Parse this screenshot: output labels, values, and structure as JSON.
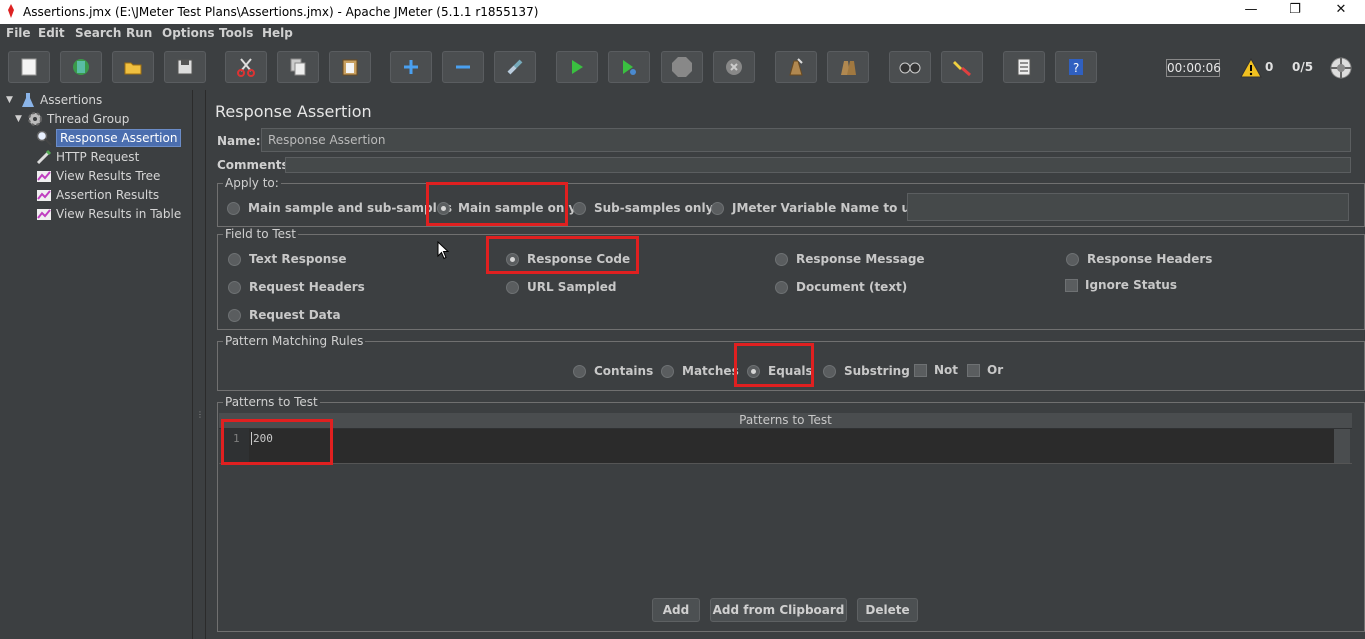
{
  "window": {
    "title": "Assertions.jmx (E:\\JMeter Test Plans\\Assertions.jmx) - Apache JMeter (5.1.1 r1855137)",
    "minimize": "—",
    "maximize": "❐",
    "close": "✕"
  },
  "menu": [
    "File",
    "Edit",
    "Search",
    "Run",
    "Options",
    "Tools",
    "Help"
  ],
  "toolbar": {
    "buttons": [
      "new-icon",
      "templates-icon",
      "open-icon",
      "save-icon",
      "cut-icon",
      "copy-icon",
      "paste-icon",
      "expand-icon",
      "collapse-icon",
      "toggle-icon",
      "start-icon",
      "start-no-pause-icon",
      "stop-icon",
      "shutdown-icon",
      "clear-icon",
      "clear-all-icon",
      "search-icon",
      "reset-search-icon",
      "function-helper-icon",
      "help-icon"
    ],
    "timer": "00:00:06",
    "warning_count": "0",
    "threads": "0/5"
  },
  "tree": {
    "root": "Assertions",
    "thread_group": "Thread Group",
    "children": [
      "Response Assertion",
      "HTTP Request",
      "View Results Tree",
      "Assertion Results",
      "View Results in Table"
    ],
    "selected": "Response Assertion"
  },
  "panel": {
    "title": "Response Assertion",
    "name_label": "Name:",
    "name_value": "Response Assertion",
    "comments_label": "Comments:",
    "apply_to": {
      "legend": "Apply to:",
      "options": [
        "Main sample and sub-samples",
        "Main sample only",
        "Sub-samples only",
        "JMeter Variable Name to use"
      ],
      "selected": "Main sample only"
    },
    "field_to_test": {
      "legend": "Field to Test",
      "options": [
        "Text Response",
        "Response Code",
        "Response Message",
        "Response Headers",
        "Request Headers",
        "URL Sampled",
        "Document (text)",
        "Request Data"
      ],
      "ignore_status": "Ignore Status",
      "selected": "Response Code"
    },
    "pattern_rules": {
      "legend": "Pattern Matching Rules",
      "options": [
        "Contains",
        "Matches",
        "Equals",
        "Substring"
      ],
      "checks": [
        "Not",
        "Or"
      ],
      "selected": "Equals"
    },
    "patterns": {
      "legend": "Patterns to Test",
      "header": "Patterns to Test",
      "line_number": "1",
      "value": "200"
    },
    "buttons": {
      "add": "Add",
      "add_clipboard": "Add from Clipboard",
      "delete": "Delete"
    }
  },
  "colors": {
    "background": "#3c3f41",
    "highlight": "#e02020",
    "selection": "#4b6eaf"
  }
}
